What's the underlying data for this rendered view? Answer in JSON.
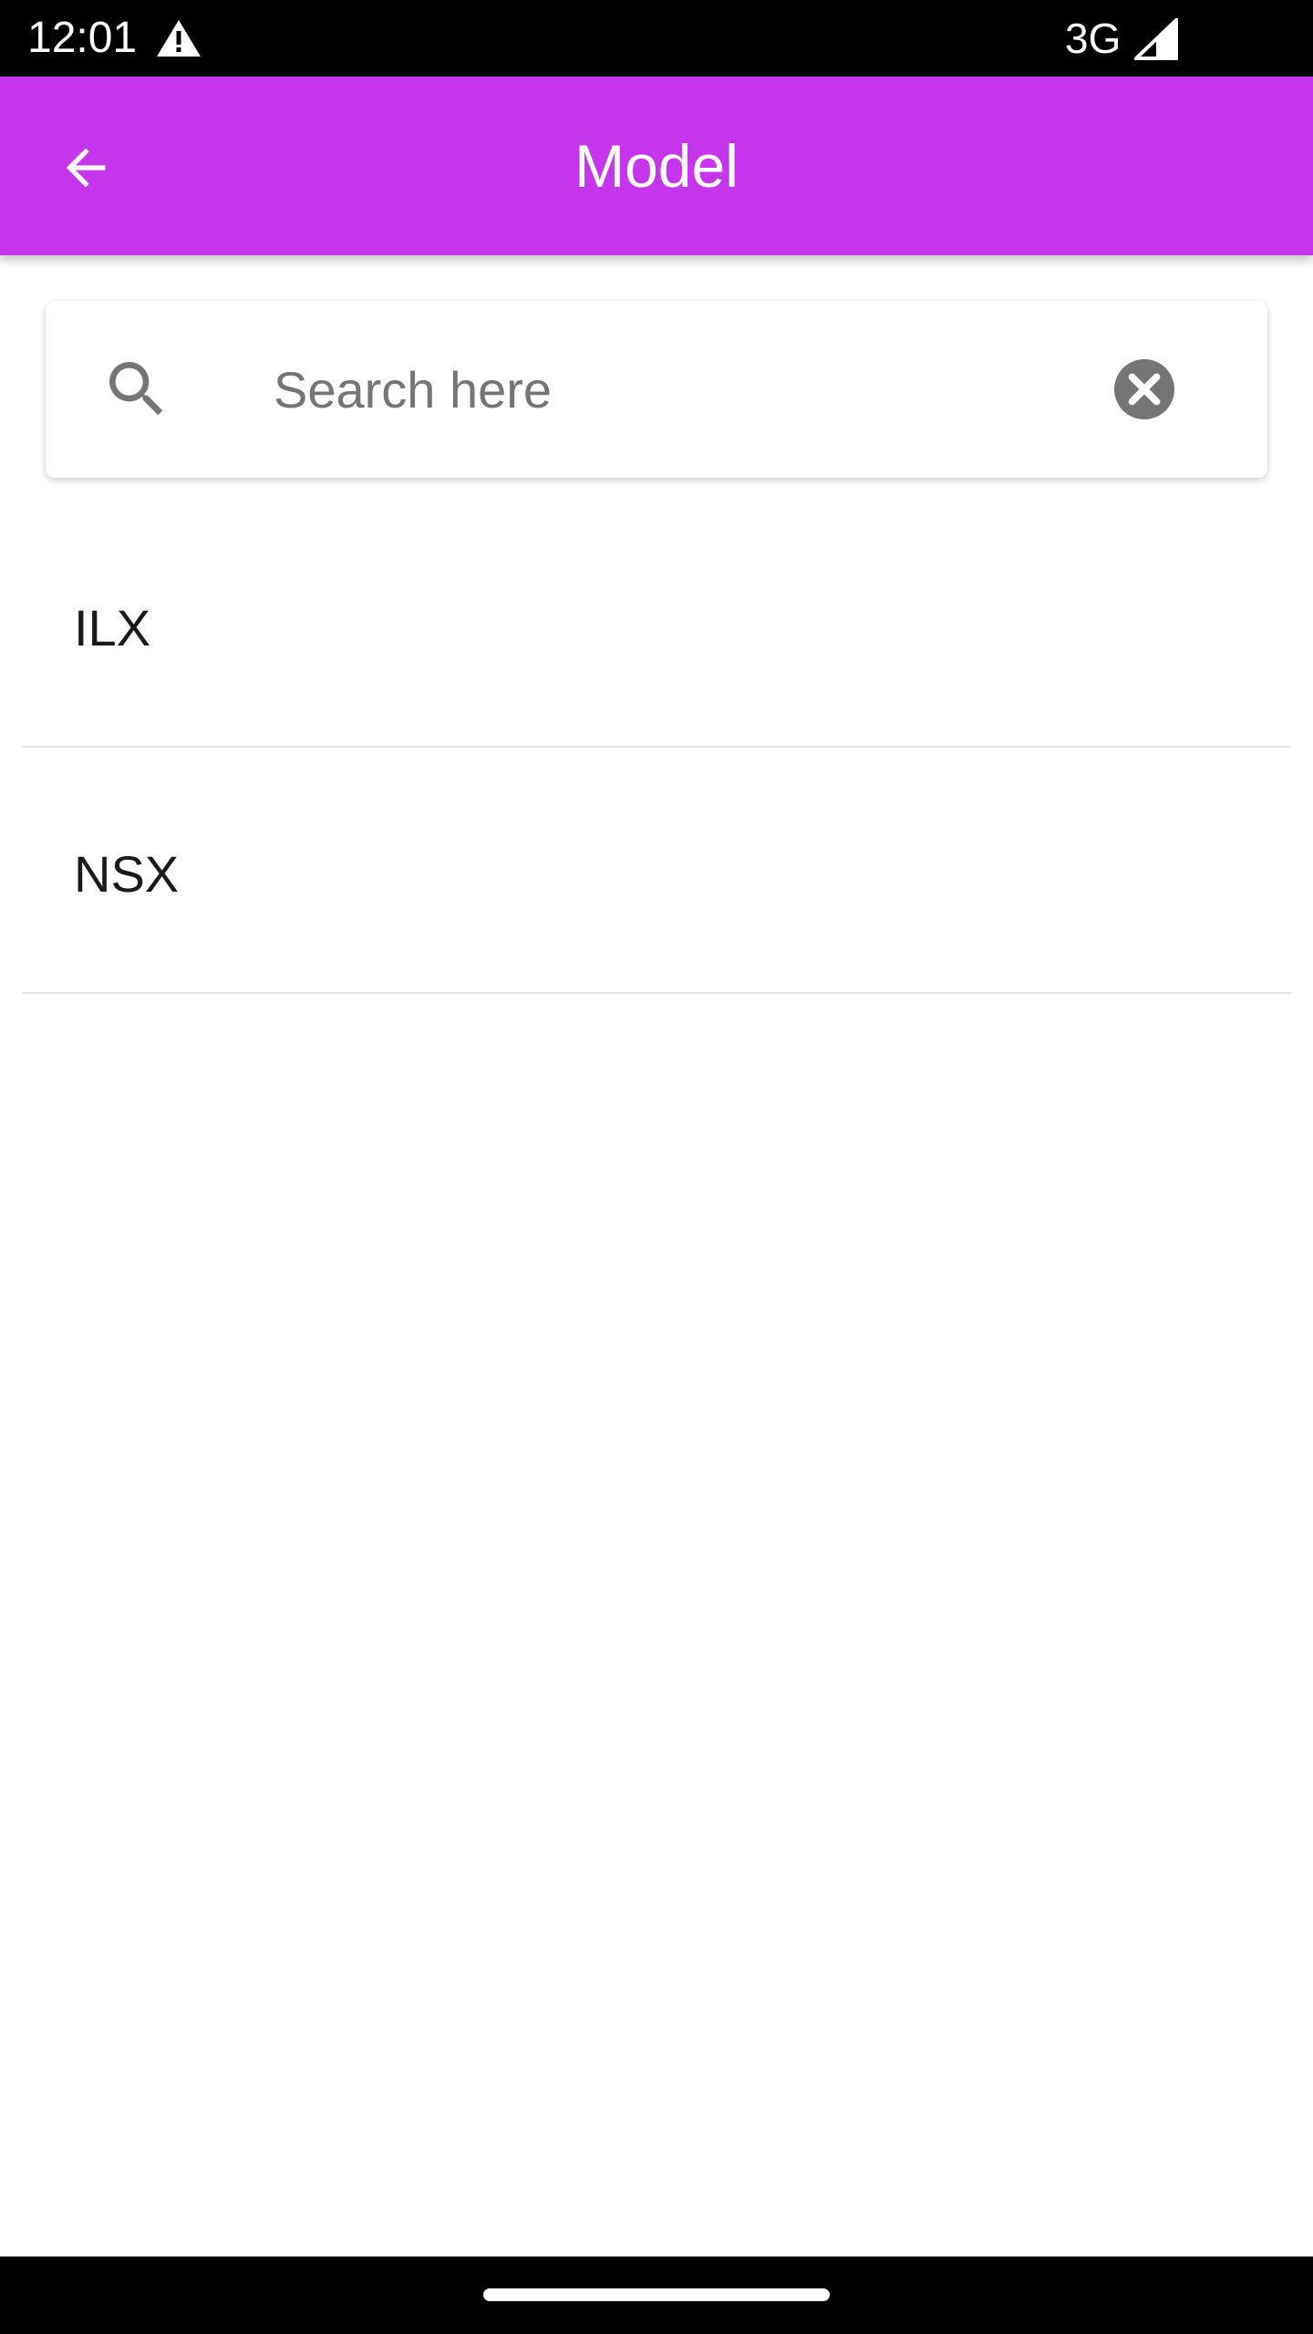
{
  "status_bar": {
    "time": "12:01",
    "network": "3G",
    "icons": [
      "warning-icon",
      "signal-icon"
    ]
  },
  "app_bar": {
    "title": "Model",
    "back_icon": "arrow-back-icon",
    "background_color": "#c535ec"
  },
  "search": {
    "placeholder": "Search here",
    "value": "",
    "search_icon": "search-icon",
    "clear_icon": "clear-icon"
  },
  "list": {
    "items": [
      {
        "label": "ILX"
      },
      {
        "label": "NSX"
      }
    ]
  }
}
